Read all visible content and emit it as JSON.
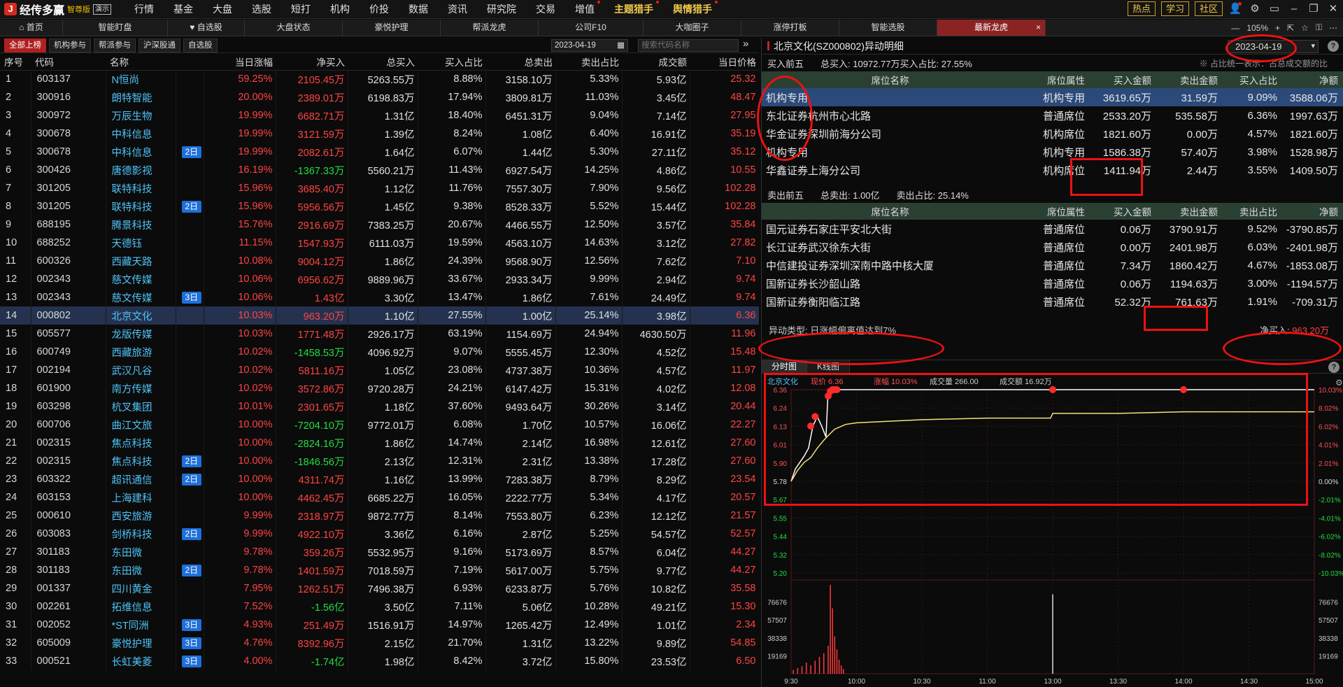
{
  "app": {
    "title": "经传多赢",
    "edition": "智尊版",
    "demo_badge": "演示",
    "menu": [
      {
        "label": "行情",
        "dot": false,
        "style": "normal"
      },
      {
        "label": "基金",
        "dot": false,
        "style": "normal"
      },
      {
        "label": "大盘",
        "dot": false,
        "style": "normal"
      },
      {
        "label": "选股",
        "dot": false,
        "style": "normal"
      },
      {
        "label": "短打",
        "dot": false,
        "style": "normal"
      },
      {
        "label": "机构",
        "dot": false,
        "style": "normal"
      },
      {
        "label": "价投",
        "dot": false,
        "style": "normal"
      },
      {
        "label": "数据",
        "dot": false,
        "style": "normal"
      },
      {
        "label": "资讯",
        "dot": false,
        "style": "normal"
      },
      {
        "label": "研究院",
        "dot": false,
        "style": "normal"
      },
      {
        "label": "交易",
        "dot": false,
        "style": "normal"
      },
      {
        "label": "增值",
        "dot": true,
        "style": "normal"
      },
      {
        "label": "主题猎手",
        "dot": true,
        "style": "yellow"
      },
      {
        "label": "舆情猎手",
        "dot": true,
        "style": "yellow"
      }
    ],
    "top_buttons": [
      "热点",
      "学习",
      "社区"
    ],
    "zoom": "105%"
  },
  "tabs": [
    {
      "label": "首页",
      "icon": "home-icon"
    },
    {
      "label": "智能盯盘",
      "icon": ""
    },
    {
      "label": "自选股",
      "icon": "heart-icon"
    },
    {
      "label": "大盘状态",
      "icon": ""
    },
    {
      "label": "豪悦护理",
      "icon": ""
    },
    {
      "label": "帮派龙虎",
      "icon": ""
    },
    {
      "label": "公司F10",
      "icon": ""
    },
    {
      "label": "大咖圈子",
      "icon": ""
    },
    {
      "label": "涨停打板",
      "icon": ""
    },
    {
      "label": "智能选股",
      "icon": ""
    },
    {
      "label": "最新龙虎",
      "icon": "",
      "active": true
    }
  ],
  "left": {
    "filters": [
      "全部上榜",
      "机构参与",
      "帮派参与",
      "沪深股通",
      "自选股"
    ],
    "date": "2023-04-19",
    "search_placeholder": "搜索代码名称",
    "columns": [
      "序号",
      "代码",
      "名称",
      "",
      "当日涨幅",
      "净买入",
      "总买入",
      "买入占比",
      "总卖出",
      "卖出占比",
      "成交额",
      "当日价格"
    ],
    "rows": [
      {
        "idx": "1",
        "code": "603137",
        "name": "N恒尚",
        "badge": "",
        "chg": "59.25%",
        "net": "2105.45万",
        "net_neg": false,
        "buy": "5263.55万",
        "buy_pct": "8.88%",
        "sell": "3158.10万",
        "sell_pct": "5.33%",
        "amount": "5.93亿",
        "price": "25.32"
      },
      {
        "idx": "2",
        "code": "300916",
        "name": "朗特智能",
        "badge": "",
        "chg": "20.00%",
        "net": "2389.01万",
        "net_neg": false,
        "buy": "6198.83万",
        "buy_pct": "17.94%",
        "sell": "3809.81万",
        "sell_pct": "11.03%",
        "amount": "3.45亿",
        "price": "48.47"
      },
      {
        "idx": "3",
        "code": "300972",
        "name": "万辰生物",
        "badge": "",
        "chg": "19.99%",
        "net": "6682.71万",
        "net_neg": false,
        "buy": "1.31亿",
        "buy_pct": "18.40%",
        "sell": "6451.31万",
        "sell_pct": "9.04%",
        "amount": "7.14亿",
        "price": "27.95"
      },
      {
        "idx": "4",
        "code": "300678",
        "name": "中科信息",
        "badge": "",
        "chg": "19.99%",
        "net": "3121.59万",
        "net_neg": false,
        "buy": "1.39亿",
        "buy_pct": "8.24%",
        "sell": "1.08亿",
        "sell_pct": "6.40%",
        "amount": "16.91亿",
        "price": "35.19"
      },
      {
        "idx": "5",
        "code": "300678",
        "name": "中科信息",
        "badge": "2日",
        "chg": "19.99%",
        "net": "2082.61万",
        "net_neg": false,
        "buy": "1.64亿",
        "buy_pct": "6.07%",
        "sell": "1.44亿",
        "sell_pct": "5.30%",
        "amount": "27.11亿",
        "price": "35.12"
      },
      {
        "idx": "6",
        "code": "300426",
        "name": "唐德影视",
        "badge": "",
        "chg": "16.19%",
        "net": "-1367.33万",
        "net_neg": true,
        "buy": "5560.21万",
        "buy_pct": "11.43%",
        "sell": "6927.54万",
        "sell_pct": "14.25%",
        "amount": "4.86亿",
        "price": "10.55"
      },
      {
        "idx": "7",
        "code": "301205",
        "name": "联特科技",
        "badge": "",
        "chg": "15.96%",
        "net": "3685.40万",
        "net_neg": false,
        "buy": "1.12亿",
        "buy_pct": "11.76%",
        "sell": "7557.30万",
        "sell_pct": "7.90%",
        "amount": "9.56亿",
        "price": "102.28"
      },
      {
        "idx": "8",
        "code": "301205",
        "name": "联特科技",
        "badge": "2日",
        "chg": "15.96%",
        "net": "5956.56万",
        "net_neg": false,
        "buy": "1.45亿",
        "buy_pct": "9.38%",
        "sell": "8528.33万",
        "sell_pct": "5.52%",
        "amount": "15.44亿",
        "price": "102.28"
      },
      {
        "idx": "9",
        "code": "688195",
        "name": "腾景科技",
        "badge": "",
        "chg": "15.76%",
        "net": "2916.69万",
        "net_neg": false,
        "buy": "7383.25万",
        "buy_pct": "20.67%",
        "sell": "4466.55万",
        "sell_pct": "12.50%",
        "amount": "3.57亿",
        "price": "35.84"
      },
      {
        "idx": "10",
        "code": "688252",
        "name": "天德钰",
        "badge": "",
        "chg": "11.15%",
        "net": "1547.93万",
        "net_neg": false,
        "buy": "6111.03万",
        "buy_pct": "19.59%",
        "sell": "4563.10万",
        "sell_pct": "14.63%",
        "amount": "3.12亿",
        "price": "27.82"
      },
      {
        "idx": "11",
        "code": "600326",
        "name": "西藏天路",
        "badge": "",
        "chg": "10.08%",
        "net": "9004.12万",
        "net_neg": false,
        "buy": "1.86亿",
        "buy_pct": "24.39%",
        "sell": "9568.90万",
        "sell_pct": "12.56%",
        "amount": "7.62亿",
        "price": "7.10"
      },
      {
        "idx": "12",
        "code": "002343",
        "name": "慈文传媒",
        "badge": "",
        "chg": "10.06%",
        "net": "6956.62万",
        "net_neg": false,
        "buy": "9889.96万",
        "buy_pct": "33.67%",
        "sell": "2933.34万",
        "sell_pct": "9.99%",
        "amount": "2.94亿",
        "price": "9.74"
      },
      {
        "idx": "13",
        "code": "002343",
        "name": "慈文传媒",
        "badge": "3日",
        "chg": "10.06%",
        "net": "1.43亿",
        "net_neg": false,
        "buy": "3.30亿",
        "buy_pct": "13.47%",
        "sell": "1.86亿",
        "sell_pct": "7.61%",
        "amount": "24.49亿",
        "price": "9.74"
      },
      {
        "idx": "14",
        "code": "000802",
        "name": "北京文化",
        "badge": "",
        "chg": "10.03%",
        "net": "963.20万",
        "net_neg": false,
        "buy": "1.10亿",
        "buy_pct": "27.55%",
        "sell": "1.00亿",
        "sell_pct": "25.14%",
        "amount": "3.98亿",
        "price": "6.36",
        "selected": true
      },
      {
        "idx": "15",
        "code": "605577",
        "name": "龙版传媒",
        "badge": "",
        "chg": "10.03%",
        "net": "1771.48万",
        "net_neg": false,
        "buy": "2926.17万",
        "buy_pct": "63.19%",
        "sell": "1154.69万",
        "sell_pct": "24.94%",
        "amount": "4630.50万",
        "price": "11.96"
      },
      {
        "idx": "16",
        "code": "600749",
        "name": "西藏旅游",
        "badge": "",
        "chg": "10.02%",
        "net": "-1458.53万",
        "net_neg": true,
        "buy": "4096.92万",
        "buy_pct": "9.07%",
        "sell": "5555.45万",
        "sell_pct": "12.30%",
        "amount": "4.52亿",
        "price": "15.48"
      },
      {
        "idx": "17",
        "code": "002194",
        "name": "武汉凡谷",
        "badge": "",
        "chg": "10.02%",
        "net": "5811.16万",
        "net_neg": false,
        "buy": "1.05亿",
        "buy_pct": "23.08%",
        "sell": "4737.38万",
        "sell_pct": "10.36%",
        "amount": "4.57亿",
        "price": "11.97"
      },
      {
        "idx": "18",
        "code": "601900",
        "name": "南方传媒",
        "badge": "",
        "chg": "10.02%",
        "net": "3572.86万",
        "net_neg": false,
        "buy": "9720.28万",
        "buy_pct": "24.21%",
        "sell": "6147.42万",
        "sell_pct": "15.31%",
        "amount": "4.02亿",
        "price": "12.08"
      },
      {
        "idx": "19",
        "code": "603298",
        "name": "杭叉集团",
        "badge": "",
        "chg": "10.01%",
        "net": "2301.65万",
        "net_neg": false,
        "buy": "1.18亿",
        "buy_pct": "37.60%",
        "sell": "9493.64万",
        "sell_pct": "30.26%",
        "amount": "3.14亿",
        "price": "20.44"
      },
      {
        "idx": "20",
        "code": "600706",
        "name": "曲江文旅",
        "badge": "",
        "chg": "10.00%",
        "net": "-7204.10万",
        "net_neg": true,
        "buy": "9772.01万",
        "buy_pct": "6.08%",
        "sell": "1.70亿",
        "sell_pct": "10.57%",
        "amount": "16.06亿",
        "price": "22.27"
      },
      {
        "idx": "21",
        "code": "002315",
        "name": "焦点科技",
        "badge": "",
        "chg": "10.00%",
        "net": "-2824.16万",
        "net_neg": true,
        "buy": "1.86亿",
        "buy_pct": "14.74%",
        "sell": "2.14亿",
        "sell_pct": "16.98%",
        "amount": "12.61亿",
        "price": "27.60"
      },
      {
        "idx": "22",
        "code": "002315",
        "name": "焦点科技",
        "badge": "2日",
        "chg": "10.00%",
        "net": "-1846.56万",
        "net_neg": true,
        "buy": "2.13亿",
        "buy_pct": "12.31%",
        "sell": "2.31亿",
        "sell_pct": "13.38%",
        "amount": "17.28亿",
        "price": "27.60"
      },
      {
        "idx": "23",
        "code": "603322",
        "name": "超讯通信",
        "badge": "2日",
        "chg": "10.00%",
        "net": "4311.74万",
        "net_neg": false,
        "buy": "1.16亿",
        "buy_pct": "13.99%",
        "sell": "7283.38万",
        "sell_pct": "8.79%",
        "amount": "8.29亿",
        "price": "23.54"
      },
      {
        "idx": "24",
        "code": "603153",
        "name": "上海建科",
        "badge": "",
        "chg": "10.00%",
        "net": "4462.45万",
        "net_neg": false,
        "buy": "6685.22万",
        "buy_pct": "16.05%",
        "sell": "2222.77万",
        "sell_pct": "5.34%",
        "amount": "4.17亿",
        "price": "20.57"
      },
      {
        "idx": "25",
        "code": "000610",
        "name": "西安旅游",
        "badge": "",
        "chg": "9.99%",
        "net": "2318.97万",
        "net_neg": false,
        "buy": "9872.77万",
        "buy_pct": "8.14%",
        "sell": "7553.80万",
        "sell_pct": "6.23%",
        "amount": "12.12亿",
        "price": "21.57"
      },
      {
        "idx": "26",
        "code": "603083",
        "name": "剑桥科技",
        "badge": "2日",
        "chg": "9.99%",
        "net": "4922.10万",
        "net_neg": false,
        "buy": "3.36亿",
        "buy_pct": "6.16%",
        "sell": "2.87亿",
        "sell_pct": "5.25%",
        "amount": "54.57亿",
        "price": "52.57"
      },
      {
        "idx": "27",
        "code": "301183",
        "name": "东田微",
        "badge": "",
        "chg": "9.78%",
        "net": "359.26万",
        "net_neg": false,
        "buy": "5532.95万",
        "buy_pct": "9.16%",
        "sell": "5173.69万",
        "sell_pct": "8.57%",
        "amount": "6.04亿",
        "price": "44.27"
      },
      {
        "idx": "28",
        "code": "301183",
        "name": "东田微",
        "badge": "2日",
        "chg": "9.78%",
        "net": "1401.59万",
        "net_neg": false,
        "buy": "7018.59万",
        "buy_pct": "7.19%",
        "sell": "5617.00万",
        "sell_pct": "5.75%",
        "amount": "9.77亿",
        "price": "44.27"
      },
      {
        "idx": "29",
        "code": "001337",
        "name": "四川黄金",
        "badge": "",
        "chg": "7.95%",
        "net": "1262.51万",
        "net_neg": false,
        "buy": "7496.38万",
        "buy_pct": "6.93%",
        "sell": "6233.87万",
        "sell_pct": "5.76%",
        "amount": "10.82亿",
        "price": "35.58"
      },
      {
        "idx": "30",
        "code": "002261",
        "name": "拓维信息",
        "badge": "",
        "chg": "7.52%",
        "net": "-1.56亿",
        "net_neg": true,
        "buy": "3.50亿",
        "buy_pct": "7.11%",
        "sell": "5.06亿",
        "sell_pct": "10.28%",
        "amount": "49.21亿",
        "price": "15.30"
      },
      {
        "idx": "31",
        "code": "002052",
        "name": "*ST同洲",
        "badge": "3日",
        "chg": "4.93%",
        "net": "251.49万",
        "net_neg": false,
        "buy": "1516.91万",
        "buy_pct": "14.97%",
        "sell": "1265.42万",
        "sell_pct": "12.49%",
        "amount": "1.01亿",
        "price": "2.34"
      },
      {
        "idx": "32",
        "code": "605009",
        "name": "豪悦护理",
        "badge": "3日",
        "chg": "4.76%",
        "net": "8392.96万",
        "net_neg": false,
        "buy": "2.15亿",
        "buy_pct": "21.70%",
        "sell": "1.31亿",
        "sell_pct": "13.22%",
        "amount": "9.89亿",
        "price": "54.85"
      },
      {
        "idx": "33",
        "code": "000521",
        "name": "长虹美菱",
        "badge": "3日",
        "chg": "4.00%",
        "net": "-1.74亿",
        "net_neg": true,
        "buy": "1.98亿",
        "buy_pct": "8.42%",
        "sell": "3.72亿",
        "sell_pct": "15.80%",
        "amount": "23.53亿",
        "price": "6.50"
      }
    ]
  },
  "right": {
    "title": "北京文化(SZ000802)异动明细",
    "date": "2023-04-19",
    "buy_summary": {
      "label": "买入前五",
      "total": "总买入: 10972.77万",
      "pct": "买入占比: 27.55%",
      "note": "※ 占比统一表示：占总成交额的比"
    },
    "columns": [
      "席位名称",
      "席位属性",
      "买入金额",
      "卖出金额",
      "买入占比",
      "净额"
    ],
    "buy_seats": [
      {
        "name": "机构专用",
        "attr": "机构专用",
        "buy": "3619.65万",
        "sell": "31.59万",
        "pct": "9.09%",
        "net": "3588.06万",
        "highlight": true
      },
      {
        "name": "东北证券杭州市心北路",
        "attr": "普通席位",
        "buy": "2533.20万",
        "sell": "535.58万",
        "pct": "6.36%",
        "net": "1997.63万"
      },
      {
        "name": "华金证券深圳前海分公司",
        "attr": "机构席位",
        "buy": "1821.60万",
        "sell": "0.00万",
        "pct": "4.57%",
        "net": "1821.60万"
      },
      {
        "name": "机构专用",
        "attr": "机构专用",
        "buy": "1586.38万",
        "sell": "57.40万",
        "pct": "3.98%",
        "net": "1528.98万"
      },
      {
        "name": "华鑫证券上海分公司",
        "attr": "机构席位",
        "buy": "1411.94万",
        "sell": "2.44万",
        "pct": "3.55%",
        "net": "1409.50万"
      }
    ],
    "sell_summary": {
      "label": "卖出前五",
      "total": "总卖出: 1.00亿",
      "pct": "卖出占比: 25.14%"
    },
    "sell_columns": [
      "席位名称",
      "席位属性",
      "买入金额",
      "卖出金额",
      "卖出占比",
      "净额"
    ],
    "sell_seats": [
      {
        "name": "国元证券石家庄平安北大街",
        "attr": "普通席位",
        "buy": "0.06万",
        "sell": "3790.91万",
        "pct": "9.52%",
        "net": "-3790.85万"
      },
      {
        "name": "长江证券武汉徐东大街",
        "attr": "普通席位",
        "buy": "0.00万",
        "sell": "2401.98万",
        "pct": "6.03%",
        "net": "-2401.98万"
      },
      {
        "name": "中信建投证券深圳深南中路中核大厦",
        "attr": "普通席位",
        "buy": "7.34万",
        "sell": "1860.42万",
        "pct": "4.67%",
        "net": "-1853.08万"
      },
      {
        "name": "国新证券长沙韶山路",
        "attr": "普通席位",
        "buy": "0.06万",
        "sell": "1194.63万",
        "pct": "3.00%",
        "net": "-1194.57万"
      },
      {
        "name": "国新证券衡阳临江路",
        "attr": "普通席位",
        "buy": "52.32万",
        "sell": "761.63万",
        "pct": "1.91%",
        "net": "-709.31万"
      }
    ],
    "anomaly": "异动类型: 日涨幅偏离值达到7%",
    "net_buy_label": "净买入:",
    "net_buy_value": "963.20万",
    "chart_tabs": [
      "分时图",
      "K线图"
    ]
  },
  "chart_data": {
    "type": "line",
    "stock": "北京文化",
    "price_label": "现价 6.36",
    "change_label": "涨幅 10.03%",
    "volume_label": "成交量 266.00",
    "amount_label": "成交额 16.92万",
    "price_ticks": [
      "6.36",
      "6.24",
      "6.13",
      "6.01",
      "5.90",
      "5.78",
      "5.67",
      "5.55",
      "5.44",
      "5.32",
      "5.20"
    ],
    "pct_ticks": [
      "10.03%",
      "8.02%",
      "6.02%",
      "4.01%",
      "2.01%",
      "0.00%",
      "-2.01%",
      "-4.01%",
      "-6.02%",
      "-8.02%",
      "-10.03%"
    ],
    "ylim": [
      5.2,
      6.36
    ],
    "volume_ticks": [
      "76676",
      "57507",
      "38338",
      "19169"
    ],
    "volume_max": 95845,
    "x_ticks": [
      "9:30",
      "10:00",
      "10:30",
      "11:00",
      "13:00",
      "13:30",
      "14:00",
      "14:30",
      "15:00"
    ],
    "x_minutes": [
      0,
      30,
      60,
      90,
      120,
      150,
      180,
      210,
      240
    ],
    "series": [
      {
        "x": [
          0,
          2,
          4,
          6,
          8,
          10,
          12,
          14,
          16,
          17,
          18,
          20,
          22,
          24,
          25,
          26,
          28,
          30,
          60,
          90,
          119,
          120,
          150,
          180,
          210,
          240
        ],
        "values": [
          5.78,
          5.86,
          5.9,
          5.94,
          5.99,
          6.13,
          6.19,
          6.13,
          6.06,
          6.36,
          6.36,
          6.36,
          6.36,
          6.36,
          6.36,
          6.36,
          6.36,
          6.36,
          6.36,
          6.36,
          6.36,
          6.36,
          6.36,
          6.36,
          6.36,
          6.36
        ]
      },
      {
        "x": [
          0,
          3,
          6,
          9,
          12,
          15,
          17,
          20,
          25,
          30,
          45,
          60,
          90,
          119,
          120,
          150,
          180,
          210,
          240
        ],
        "values": [
          5.78,
          5.85,
          5.9,
          5.93,
          5.99,
          6.04,
          6.07,
          6.11,
          6.14,
          6.15,
          6.16,
          6.17,
          6.18,
          6.18,
          6.21,
          6.21,
          6.22,
          6.22,
          6.22
        ]
      }
    ],
    "markers_x": [
      9,
      11,
      17,
      18,
      19,
      20,
      21,
      120,
      180
    ],
    "markers_y": [
      6.13,
      6.19,
      6.32,
      6.35,
      6.36,
      6.36,
      6.36,
      6.36,
      6.36
    ],
    "volume_x": [
      1,
      3,
      5,
      7,
      9,
      11,
      13,
      15,
      17,
      18,
      19,
      20,
      21,
      22,
      23,
      24,
      120
    ],
    "volume": [
      4000,
      6000,
      8000,
      12000,
      9000,
      14000,
      18000,
      22000,
      30000,
      95000,
      70000,
      40000,
      26000,
      15000,
      9000,
      5000,
      85000
    ],
    "colors": {
      "price_line": "#ffffff",
      "avg_line": "#f4e27a",
      "up": "#ff3b3b",
      "down": "#22dd44",
      "marker": "#ff2a2a"
    }
  }
}
